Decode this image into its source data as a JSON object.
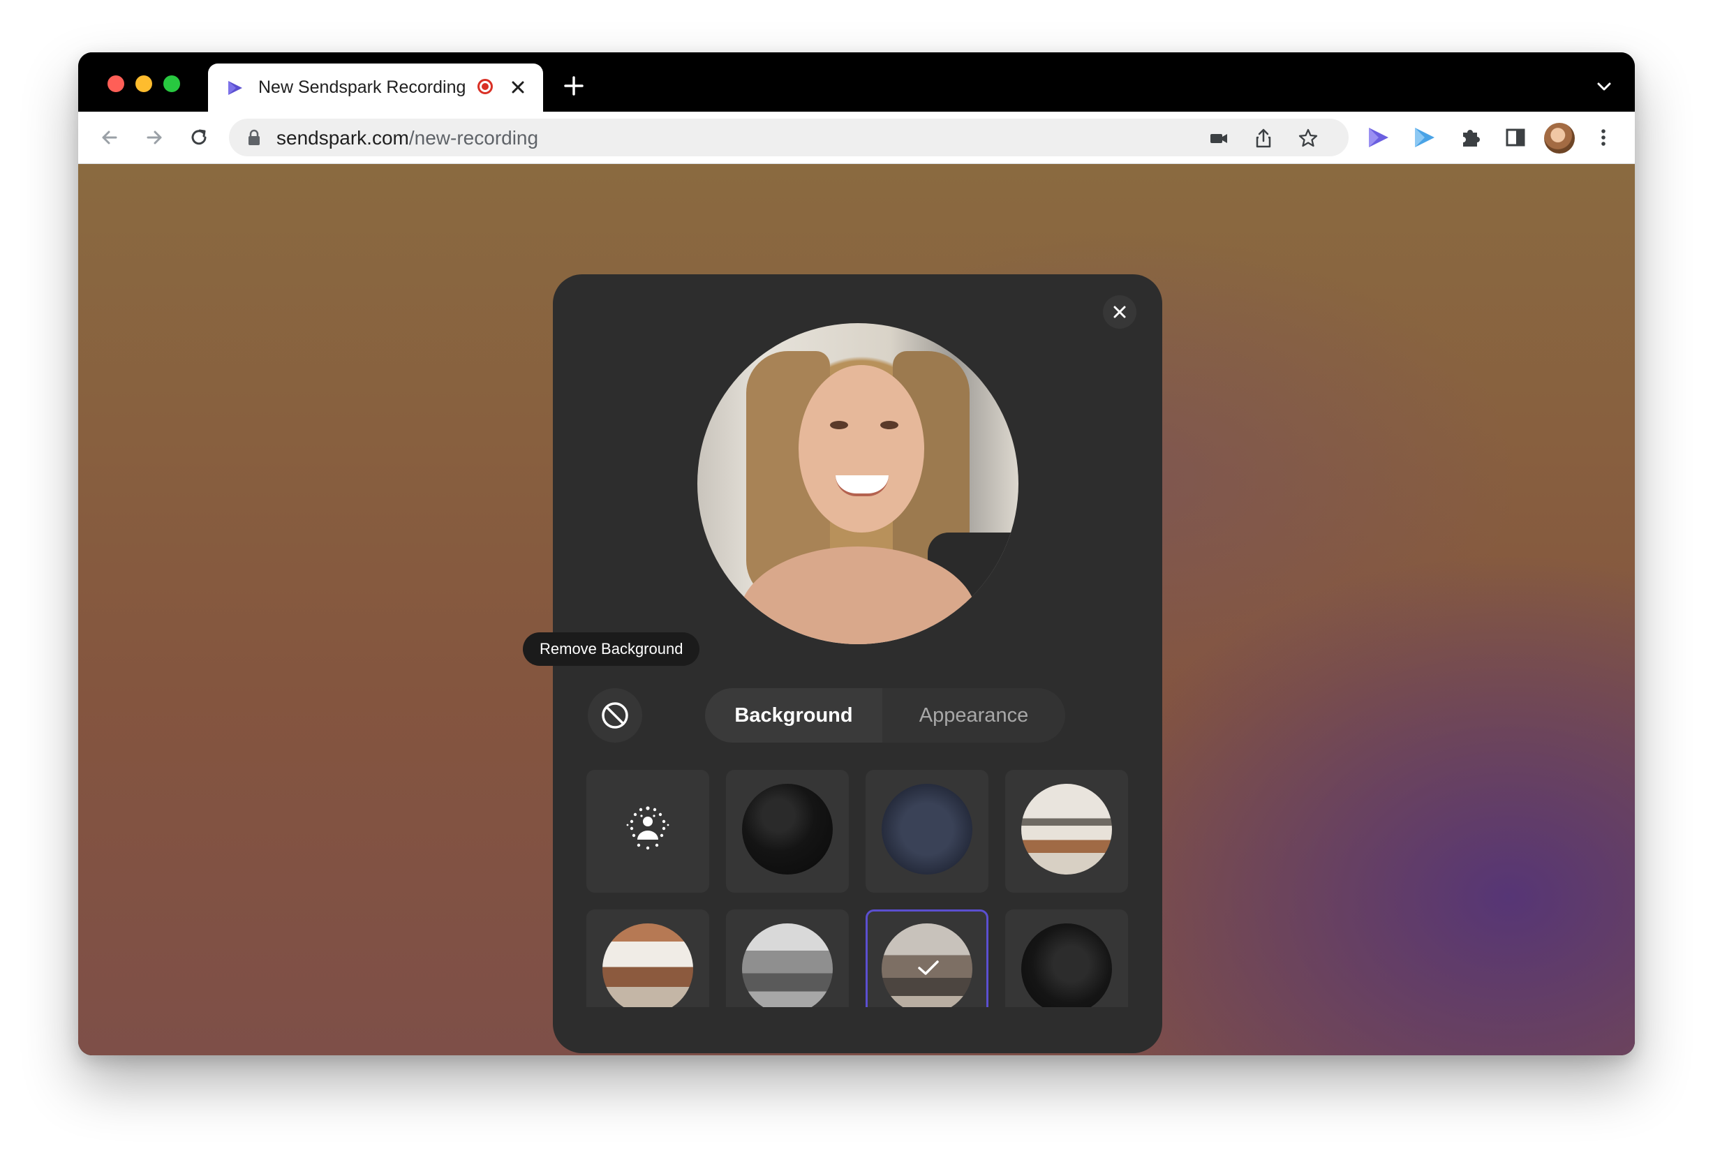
{
  "browser": {
    "tab": {
      "title": "New Sendspark Recording",
      "favicon": "sendspark-logo-icon",
      "recording_indicator": "recording-dot-icon"
    },
    "omnibox": {
      "url_domain": "sendspark.com",
      "url_path": "/new-recording"
    },
    "colors": {
      "tab_strip": "#000000",
      "toolbar": "#ffffff",
      "omnibox": "#efefef",
      "recording_red": "#d93025"
    }
  },
  "modal": {
    "tooltip": "Remove Background",
    "tabs": [
      {
        "label": "Background",
        "active": true
      },
      {
        "label": "Appearance",
        "active": false
      }
    ],
    "backgrounds": [
      {
        "name": "blur",
        "icon": "blur-person-icon",
        "selected": false
      },
      {
        "name": "black texture",
        "selected": false
      },
      {
        "name": "denim texture",
        "selected": false
      },
      {
        "name": "living room",
        "selected": false
      },
      {
        "name": "brick office",
        "selected": false
      },
      {
        "name": "open office",
        "selected": false
      },
      {
        "name": "office lounge",
        "selected": true
      },
      {
        "name": "dark feathers",
        "selected": false
      }
    ],
    "colors": {
      "panel": "#2d2d2d",
      "tile": "#363636",
      "selected_border": "#5b4fd0",
      "tooltip": "#1b1b1b"
    }
  }
}
